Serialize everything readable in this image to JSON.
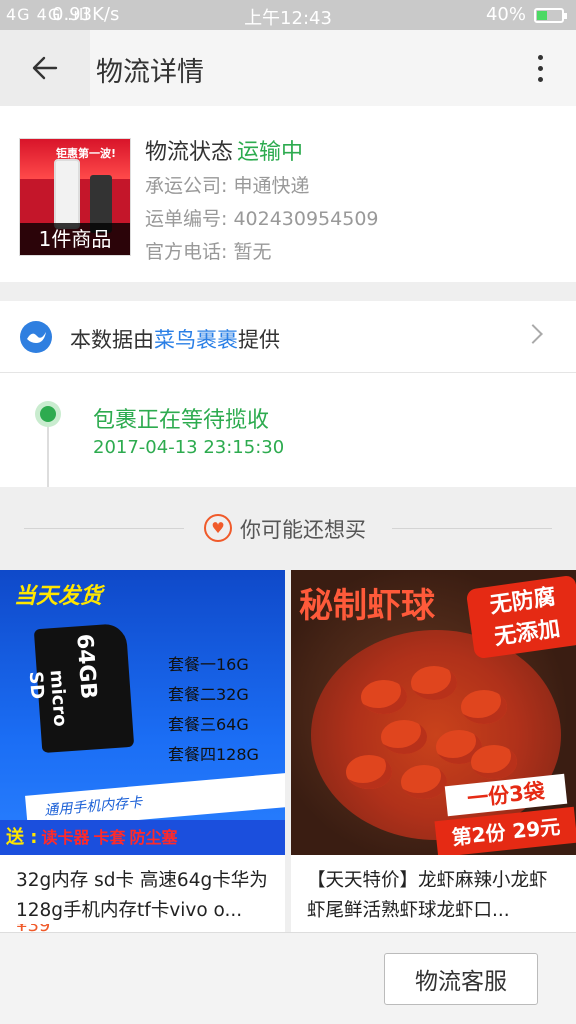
{
  "status_bar": {
    "signal": "4G 4G .ıll",
    "net_speed": "0.93K/s",
    "clock": "上午12:43",
    "battery_pct": "40%",
    "battery_level": 0.4,
    "battery_color": "#4cd964"
  },
  "header": {
    "back_icon": "back-arrow-icon",
    "title": "物流详情",
    "more_icon": "more-vertical-icon"
  },
  "package": {
    "item_count": "1件商品",
    "thumb_promo": "钜惠第一波!",
    "status_label": "物流状态",
    "status_value": "运输中",
    "status_color": "#2dab4f",
    "carrier": "承运公司: 申通快递",
    "tracking": "运单编号: 402430954509",
    "phone": "官方电话: 暂无"
  },
  "provider": {
    "prefix": "本数据由",
    "link": "菜鸟裹裹",
    "suffix": "提供",
    "link_color": "#2a7fe6"
  },
  "timeline": {
    "events": [
      {
        "text": "包裹正在等待揽收",
        "time": "2017-04-13 23:15:30"
      }
    ]
  },
  "recommend": {
    "heading": "你可能还想买",
    "accent": "#f05a2a",
    "products": [
      {
        "name": "32g内存 sd卡 高速64g卡华为128g手机内存tf卡vivo o...",
        "img": {
          "brand": "当天发货",
          "card_cap": "64GB",
          "card_text": "micro SD",
          "specs": [
            "套餐一16G",
            "套餐二32G",
            "套餐三64G",
            "套餐四128G"
          ],
          "ribbon": "通用手机内存卡",
          "gift_label": "送 :",
          "gifts": [
            "读卡器",
            "卡套",
            "防尘塞"
          ]
        }
      },
      {
        "name": "【天天特价】龙虾麻辣小龙虾虾尾鲜活熟虾球龙虾口...",
        "img": {
          "title": "秘制虾球",
          "tag1_line1": "无防腐",
          "tag1_line2": "无添加",
          "tag2": "一份3袋",
          "tag3": "第2份 29元"
        }
      }
    ]
  },
  "bottom": {
    "service_button": "物流客服"
  }
}
